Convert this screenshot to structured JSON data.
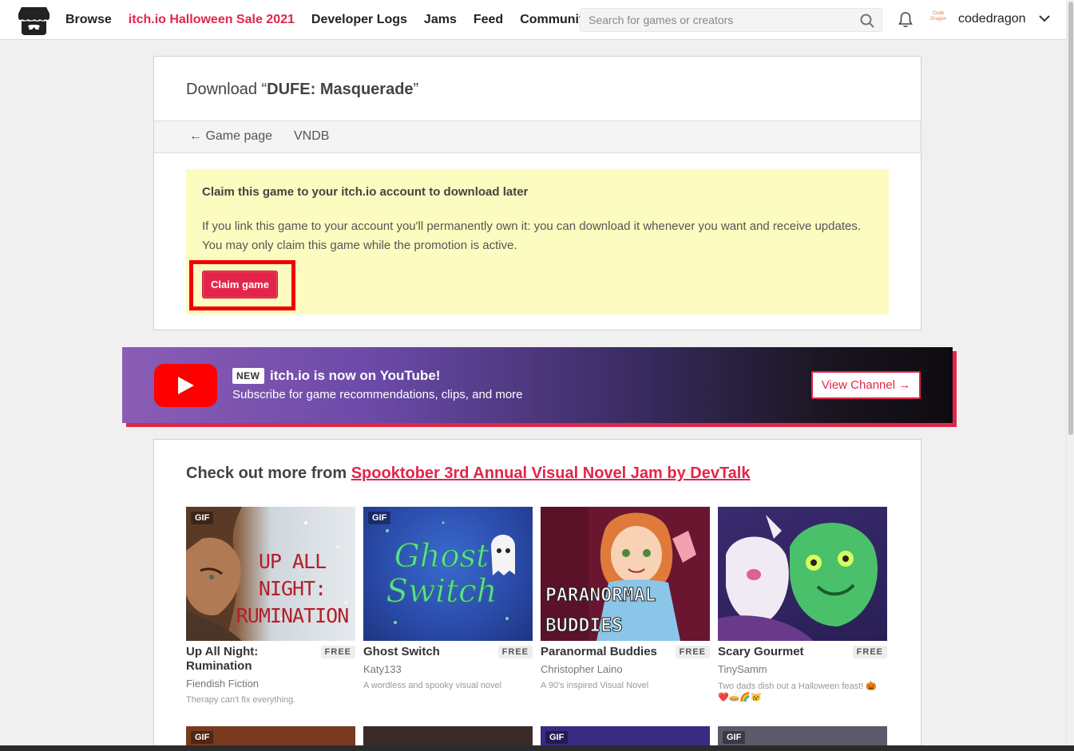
{
  "header": {
    "nav": [
      "Browse",
      "itch.io Halloween Sale 2021",
      "Developer Logs",
      "Jams",
      "Feed",
      "Community"
    ],
    "search_placeholder": "Search for games or creators",
    "username": "codedragon",
    "avatar_text": "Code Dragon"
  },
  "download": {
    "title_prefix": "Download “",
    "title_game": "DUFE: Masquerade",
    "title_suffix": "”",
    "subnav_game_page": "← Game page",
    "subnav_vndb": "VNDB",
    "claim_heading": "Claim this game to your itch.io account to download later",
    "claim_text": "If you link this game to your account you'll permanently own it: you can download it whenever you want and receive updates. You may only claim this game while the promotion is active.",
    "claim_button": "Claim game"
  },
  "youtube": {
    "badge": "NEW",
    "title": "itch.io is now on YouTube!",
    "subtitle": "Subscribe for game recommendations, clips, and more",
    "button": "View Channel →"
  },
  "more": {
    "heading_prefix": "Check out more from ",
    "heading_link": "Spooktober 3rd Annual Visual Novel Jam by DevTalk",
    "games": [
      {
        "title": "Up All Night: Rumination",
        "badge": "GIF",
        "price": "FREE",
        "author": "Fiendish Fiction",
        "desc": "Therapy can't fix everything.",
        "cover_text": "UP ALL NIGHT: RUMINATION"
      },
      {
        "title": "Ghost Switch",
        "badge": "GIF",
        "price": "FREE",
        "author": "Katy133",
        "desc": "A wordless and spooky visual novel",
        "cover_text": "Ghost Switch"
      },
      {
        "title": "Paranormal Buddies",
        "badge": "",
        "price": "FREE",
        "author": "Christopher Laino",
        "desc": "A 90's inspired Visual Novel",
        "cover_text": "PARANORMAL BUDDIES"
      },
      {
        "title": "Scary Gourmet",
        "badge": "",
        "price": "FREE",
        "author": "TinySamm",
        "desc": "Two dads dish out a Halloween feast! 🎃❤️🥧🌈😿",
        "cover_text": ""
      }
    ],
    "row2_badges": [
      "GIF",
      "",
      "GIF",
      "GIF"
    ]
  }
}
